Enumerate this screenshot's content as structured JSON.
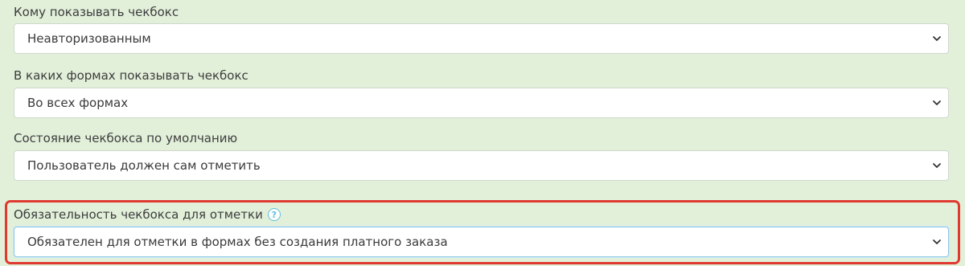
{
  "fields": [
    {
      "label": "Кому показывать чекбокс",
      "value": "Неавторизованным"
    },
    {
      "label": "В каких формах показывать чекбокс",
      "value": "Во всех формах"
    },
    {
      "label": "Состояние чекбокса по умолчанию",
      "value": "Пользователь должен сам отметить"
    },
    {
      "label": "Обязательность чекбокса для отметки",
      "value": "Обязателен для отметки в формах без создания платного заказа",
      "help_icon": "question-circle-icon"
    }
  ],
  "colors": {
    "background": "#e2f0da",
    "highlight_border": "#e0392f",
    "help_icon": "#5bc0de"
  }
}
